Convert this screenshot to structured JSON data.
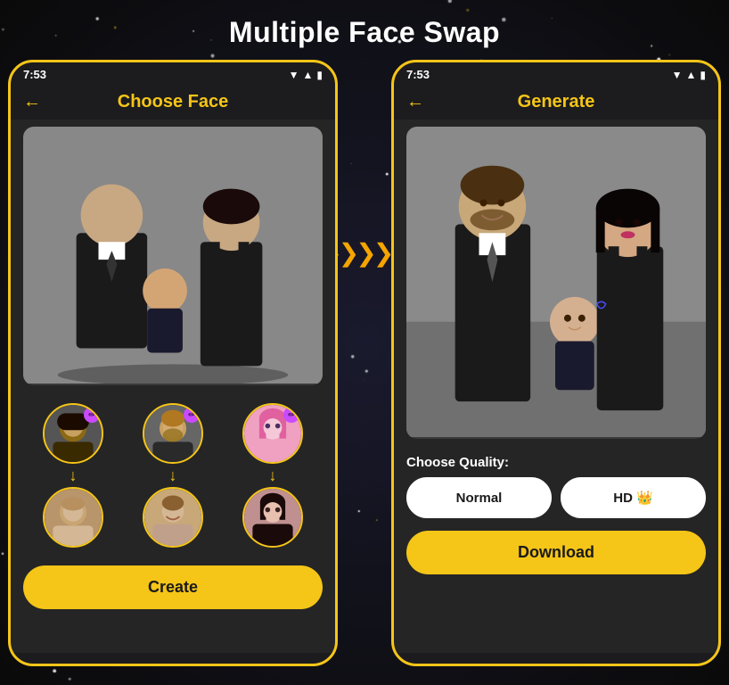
{
  "page": {
    "title": "Multiple Face Swap",
    "background": "#0a0a0a"
  },
  "left_phone": {
    "status_time": "7:53",
    "back_label": "←",
    "header_title": "Choose Face",
    "create_button_label": "Create",
    "faces": {
      "source": [
        {
          "label": "person1-source",
          "color": "#555"
        },
        {
          "label": "person2-source",
          "color": "#666"
        },
        {
          "label": "person3-source",
          "color": "#c06080"
        }
      ],
      "target": [
        {
          "label": "person1-target",
          "color": "#999"
        },
        {
          "label": "person2-target",
          "color": "#a08060"
        },
        {
          "label": "person3-target",
          "color": "#a07090"
        }
      ]
    }
  },
  "right_phone": {
    "status_time": "7:53",
    "back_label": "←",
    "header_title": "Generate",
    "quality_label": "Choose Quality:",
    "quality_options": [
      {
        "label": "Normal",
        "active": true
      },
      {
        "label": "HD 👑",
        "active": false
      }
    ],
    "download_button_label": "Download"
  },
  "middle_arrow": "❯❯❯❯❯",
  "icons": {
    "back": "←",
    "edit": "✏",
    "signal": "▼",
    "wifi": "▲",
    "battery": "▮"
  }
}
